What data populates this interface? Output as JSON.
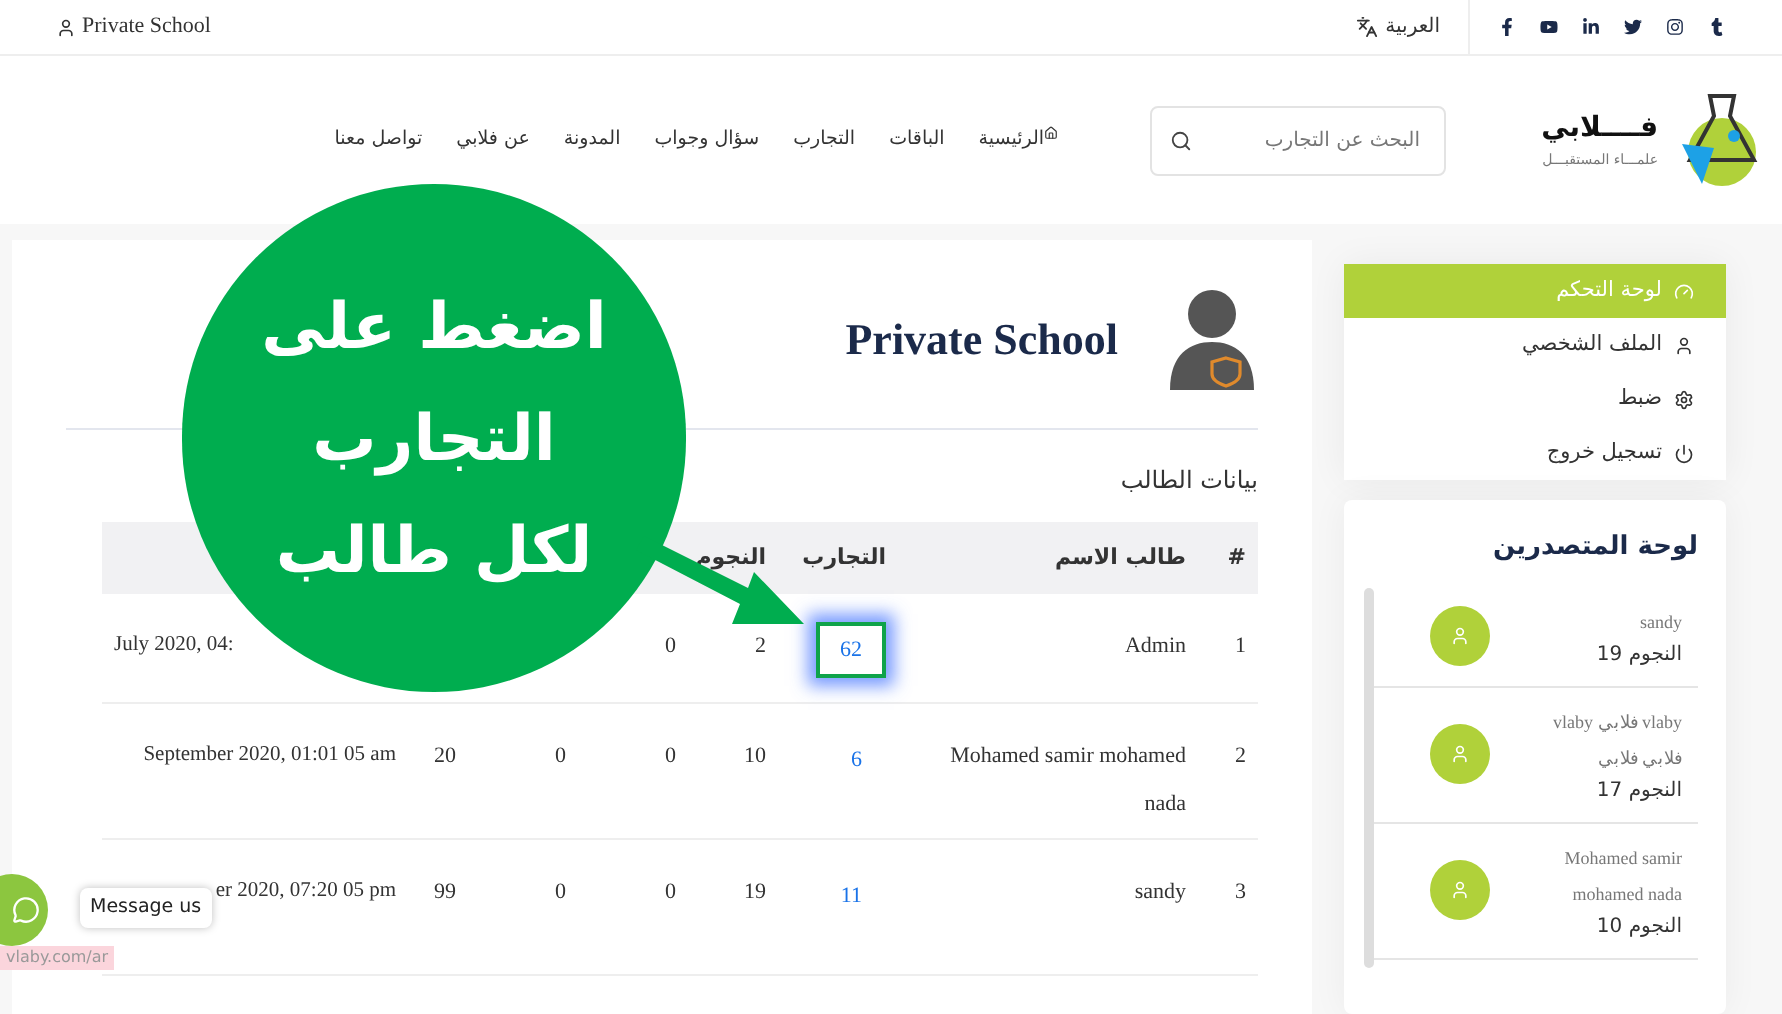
{
  "top_bar": {
    "language": "العربية",
    "user": "Private School"
  },
  "header": {
    "logo_title": "فــــلابي",
    "logo_tagline": "علمـــاء المستقبـــل",
    "search": {
      "placeholder": "البحث عن التجارب"
    },
    "nav": [
      "الرئيسية",
      "الباقات",
      "التجارب",
      "سؤال وجواب",
      "المدونة",
      "عن فلابي",
      "تواصل معنا"
    ]
  },
  "sidebar": {
    "menu": [
      {
        "label": "لوحة التحكم",
        "selected": true
      },
      {
        "label": "الملف الشخصي",
        "selected": false
      },
      {
        "label": "ضبط",
        "selected": false
      },
      {
        "label": "تسجيل خروج",
        "selected": false
      }
    ],
    "leaderboard": {
      "title": "لوحة المتصدرين",
      "entries": [
        {
          "name": "sandy",
          "score": "النجوم 19"
        },
        {
          "name": "vlaby فلابي vlaby فلابي فلابي",
          "score": "النجوم 17"
        },
        {
          "name": "Mohamed samir mohamed nada",
          "score": "النجوم 10"
        }
      ]
    }
  },
  "profile": {
    "name": "Private School"
  },
  "students": {
    "title": "بيانات الطالب",
    "columns": [
      "#",
      "طالب الاسم",
      "التجارب",
      "النجوم"
    ],
    "rows": [
      {
        "cells": [
          "1",
          "Admin",
          "62",
          "2",
          "0",
          null,
          null,
          "July 2020, 04:"
        ],
        "highlighted": true
      },
      {
        "cells": [
          "2",
          "Mohamed samir mohamed nada",
          "6",
          "10",
          "0",
          "0",
          "20",
          "September 2020, 01:01 05 am"
        ],
        "highlighted": false
      },
      {
        "cells": [
          "3",
          "sandy",
          "11",
          "19",
          "0",
          "0",
          "99",
          "er 2020, 07:20 05 pm"
        ],
        "highlighted": false
      }
    ]
  },
  "callout": {
    "lines": [
      "اضغط على",
      "التجارب",
      "لكل طالب"
    ]
  },
  "chat": {
    "tooltip": "Message us"
  },
  "status_url": "vlaby.com/ar"
}
